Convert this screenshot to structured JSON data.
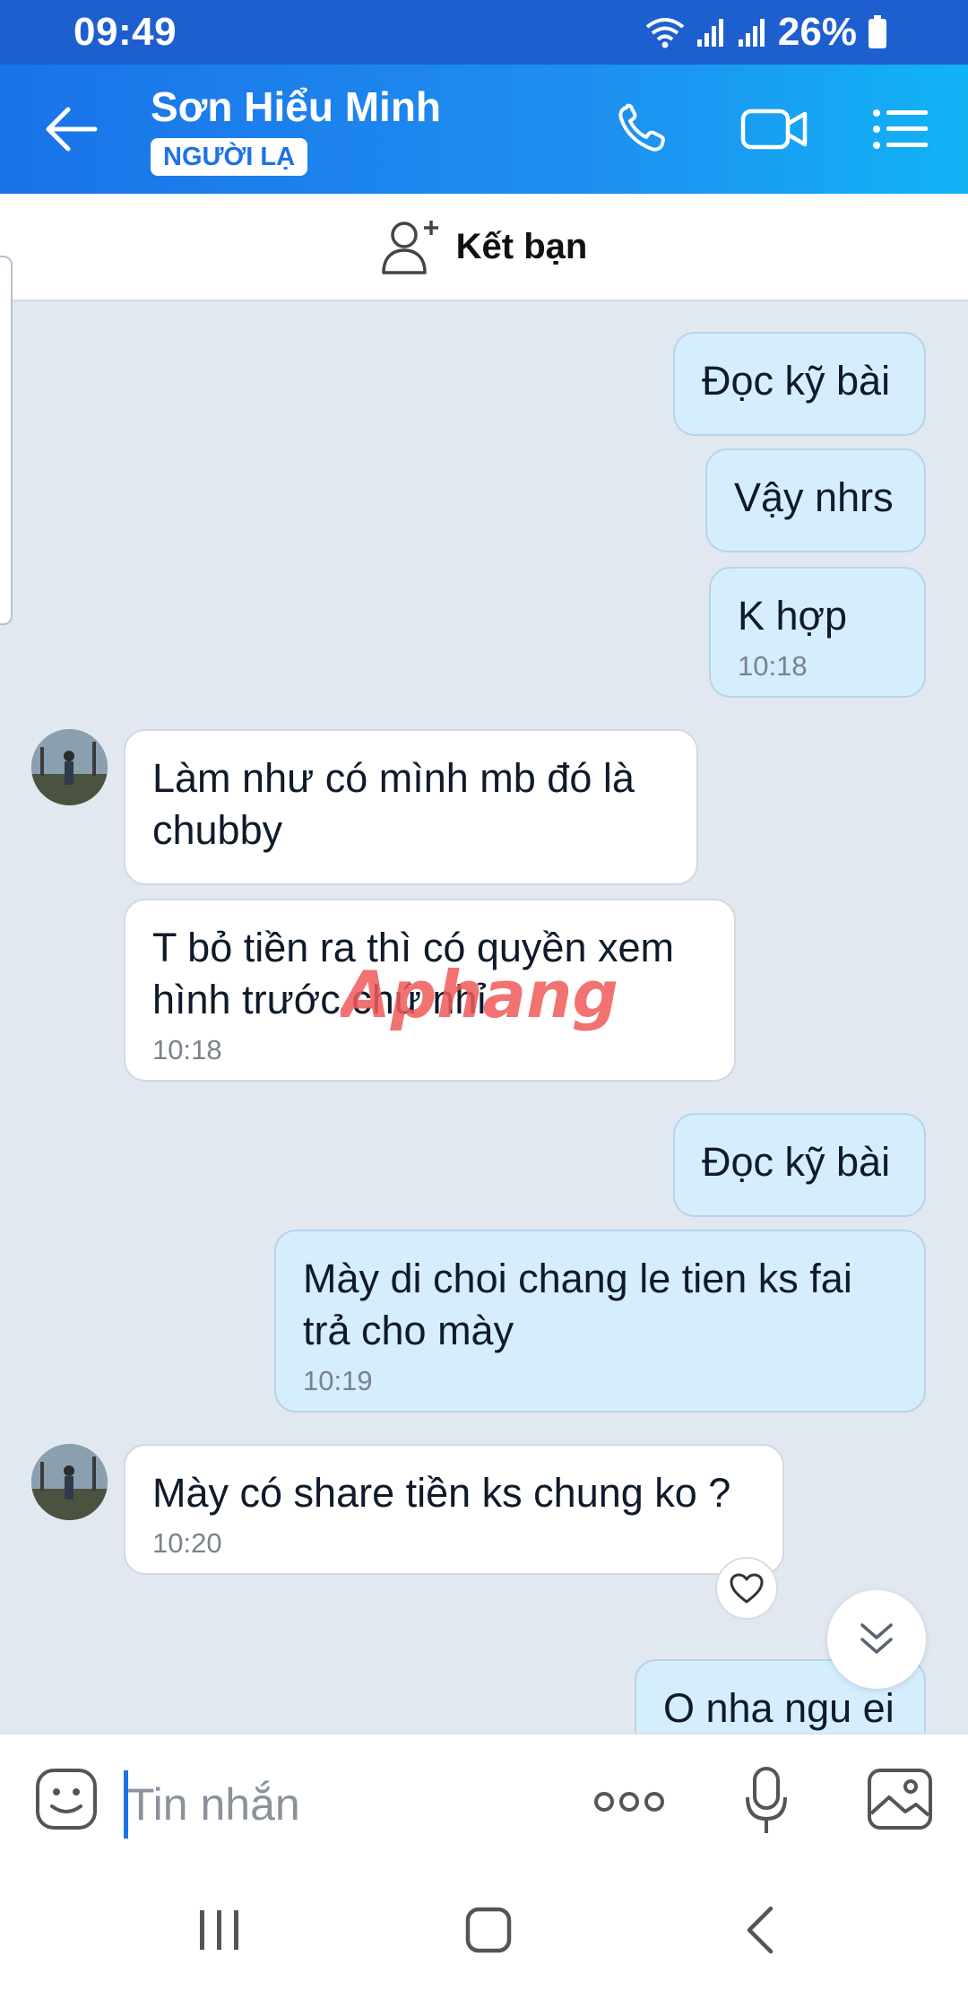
{
  "status_bar": {
    "time": "09:49",
    "battery": "26%"
  },
  "header": {
    "name": "Sơn Hiểu Minh",
    "badge": "NGƯỜI LẠ"
  },
  "add_friend": {
    "label": "Kết bạn"
  },
  "messages": [
    {
      "from": "me",
      "text": "Đọc kỹ bài"
    },
    {
      "from": "me",
      "text": "Vậy nhrs"
    },
    {
      "from": "me",
      "text": "K hợp",
      "time": "10:18"
    },
    {
      "from": "them",
      "text": "Làm như có mình mb đó là chubby"
    },
    {
      "from": "them",
      "text": "T bỏ tiền ra thì có quyền xem hình trước chứ nhỉ",
      "time": "10:18"
    },
    {
      "from": "me",
      "text": "Đọc kỹ bài"
    },
    {
      "from": "me",
      "text": "Mày di choi chang le tien ks fai trả cho mày",
      "time": "10:19"
    },
    {
      "from": "them",
      "text": "Mày có share tiền ks chung ko ?",
      "time": "10:20"
    },
    {
      "from": "me",
      "text": "O nha ngu ei"
    }
  ],
  "watermark": "Aphang",
  "input": {
    "placeholder": "Tin nhắn"
  },
  "colors": {
    "header": "#1a73e8",
    "my_bubble": "#d4eefe",
    "their_bubble": "#ffffff",
    "background": "#e2e8f0"
  }
}
